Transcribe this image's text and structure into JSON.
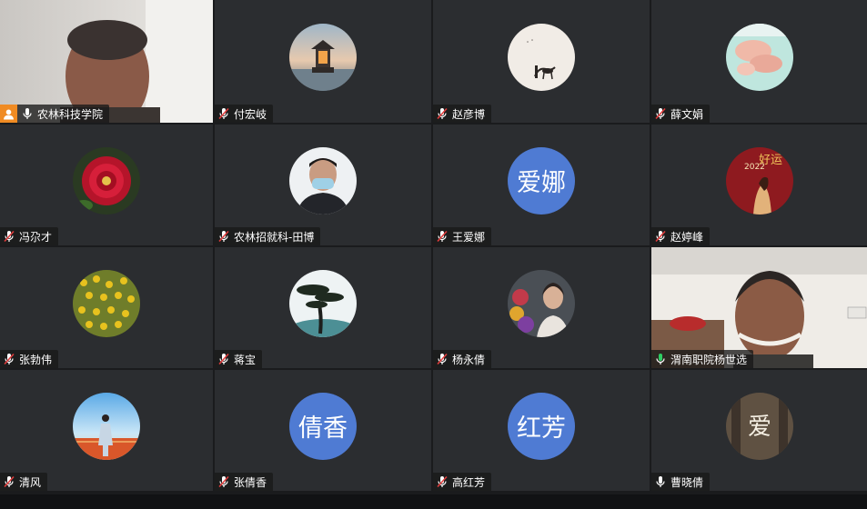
{
  "participants": [
    {
      "name": "农林科技学院",
      "mic": "on",
      "host": true,
      "kind": "video-man-indoor"
    },
    {
      "name": "付宏岐",
      "mic": "muted",
      "kind": "avatar-pagoda"
    },
    {
      "name": "赵彦博",
      "mic": "muted",
      "kind": "avatar-ink-horse"
    },
    {
      "name": "薛文娟",
      "mic": "muted",
      "kind": "avatar-hands"
    },
    {
      "name": "冯尕才",
      "mic": "muted",
      "kind": "avatar-red-peony"
    },
    {
      "name": "农林招就科-田博",
      "mic": "muted",
      "kind": "avatar-man-mask"
    },
    {
      "name": "王爱娜",
      "mic": "muted",
      "kind": "initials",
      "initials": "爱娜"
    },
    {
      "name": "赵婷峰",
      "mic": "muted",
      "kind": "avatar-2022-red",
      "avatar_text": "好运",
      "avatar_year": "2022"
    },
    {
      "name": "张勃伟",
      "mic": "muted",
      "kind": "avatar-yellow-flowers"
    },
    {
      "name": "蒋宝",
      "mic": "muted",
      "kind": "avatar-pine-tree"
    },
    {
      "name": "杨永倩",
      "mic": "muted",
      "kind": "avatar-woman-flowers"
    },
    {
      "name": "渭南职院杨世选",
      "mic": "on",
      "active_speaker": true,
      "kind": "video-man-smiling"
    },
    {
      "name": "清风",
      "mic": "muted",
      "kind": "avatar-girl-sky"
    },
    {
      "name": "张倩香",
      "mic": "muted",
      "kind": "initials",
      "initials": "倩香"
    },
    {
      "name": "高红芳",
      "mic": "muted",
      "kind": "initials",
      "initials": "红芳"
    },
    {
      "name": "曹晓倩",
      "mic": "on",
      "kind": "avatar-love-calligraphy",
      "avatar_text": "爱"
    }
  ],
  "colors": {
    "tile_bg": "#2b2d30",
    "initials_bg": "#4f7bd3",
    "active_border": "#29c35c",
    "host_badge": "#f08b23",
    "mic_on": "#ffffff",
    "mic_muted_slash": "#e03c3c"
  }
}
